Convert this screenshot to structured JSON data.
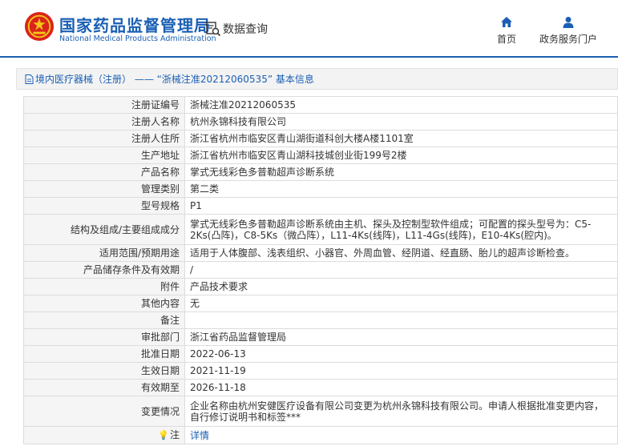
{
  "header": {
    "title": "国家药品监督管理局",
    "subtitle": "National Medical Products Administration",
    "search_label": "数据查询",
    "brand_color": "#1a5fb4"
  },
  "nav": {
    "home": "首页",
    "services": "政务服务门户"
  },
  "breadcrumb": "境内医疗器械（注册） —— “浙械注准20212060535” 基本信息",
  "rows": [
    {
      "label": "注册证编号",
      "value": "浙械注准20212060535"
    },
    {
      "label": "注册人名称",
      "value": "杭州永锦科技有限公司"
    },
    {
      "label": "注册人住所",
      "value": "浙江省杭州市临安区青山湖街道科创大楼A楼1101室"
    },
    {
      "label": "生产地址",
      "value": "浙江省杭州市临安区青山湖科技城创业街199号2楼"
    },
    {
      "label": "产品名称",
      "value": "掌式无线彩色多普勒超声诊断系统"
    },
    {
      "label": "管理类别",
      "value": "第二类"
    },
    {
      "label": "型号规格",
      "value": "P1"
    },
    {
      "label": "结构及组成/主要组成成分",
      "value": "掌式无线彩色多普勒超声诊断系统由主机、探头及控制型软件组成；可配置的探头型号为：C5-2Ks(凸阵)，C8-5Ks（微凸阵），L11-4Ks(线阵)，L11-4Gs(线阵)，E10-4Ks(腔内)。"
    },
    {
      "label": "适用范围/预期用途",
      "value": "适用于人体腹部、浅表组织、小器官、外周血管、经阴道、经直肠、胎儿的超声诊断检查。"
    },
    {
      "label": "产品储存条件及有效期",
      "value": "/"
    },
    {
      "label": "附件",
      "value": "产品技术要求"
    },
    {
      "label": "其他内容",
      "value": "无"
    },
    {
      "label": "备注",
      "value": ""
    },
    {
      "label": "审批部门",
      "value": "浙江省药品监督管理局"
    },
    {
      "label": "批准日期",
      "value": "2022-06-13"
    },
    {
      "label": "生效日期",
      "value": "2021-11-19"
    },
    {
      "label": "有效期至",
      "value": "2026-11-18"
    },
    {
      "label": "变更情况",
      "value": "企业名称由杭州安健医疗设备有限公司变更为杭州永锦科技有限公司。申请人根据批准变更内容，自行修订说明书和标签***"
    }
  ],
  "note_row": {
    "label": "注",
    "link": "详情"
  }
}
